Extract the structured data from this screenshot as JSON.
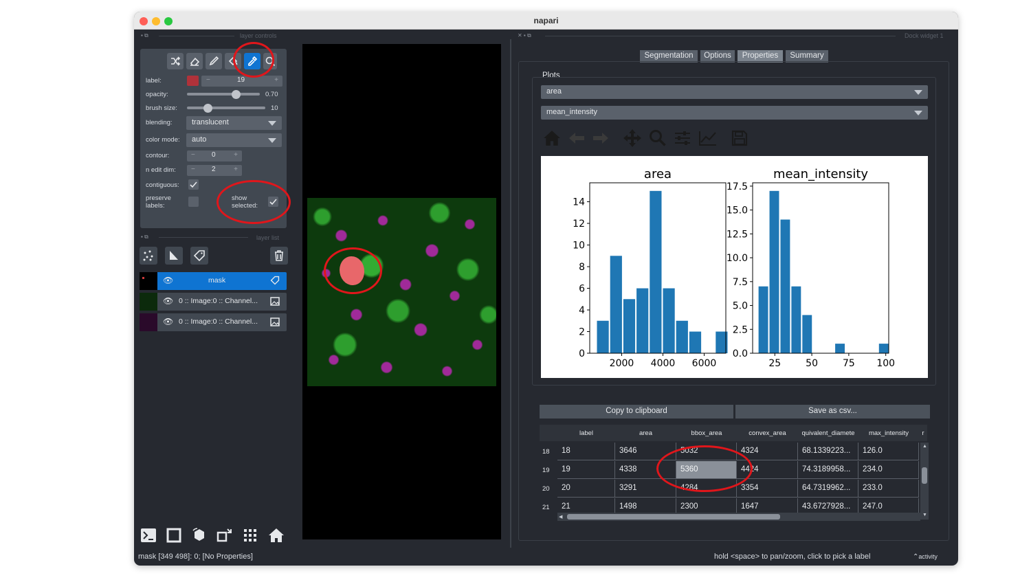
{
  "window": {
    "title": "napari"
  },
  "layer_controls": {
    "title": "layer controls",
    "label": {
      "name": "label:",
      "value": "19",
      "color": "#b0323a"
    },
    "opacity": {
      "name": "opacity:",
      "value": "0.70",
      "fraction": 0.7
    },
    "brush_size": {
      "name": "brush size:",
      "value": "10",
      "fraction": 0.2
    },
    "blending": {
      "name": "blending:",
      "value": "translucent"
    },
    "color_mode": {
      "name": "color mode:",
      "value": "auto"
    },
    "contour": {
      "name": "contour:",
      "value": "0"
    },
    "n_edit_dim": {
      "name": "n edit dim:",
      "value": "2"
    },
    "contiguous": {
      "name": "contiguous:",
      "checked": true
    },
    "preserve_labels": {
      "name": "preserve labels:",
      "checked": false
    },
    "show_selected": {
      "name": "show selected:",
      "checked": true
    },
    "tools": [
      "shuffle-icon",
      "eraser-icon",
      "paint-brush-icon",
      "fill-bucket-icon",
      "color-picker-icon",
      "zoom-icon"
    ],
    "active_tool": "color-picker-icon"
  },
  "layer_list": {
    "title": "layer list",
    "layers": [
      {
        "name": "mask",
        "selected": true
      },
      {
        "name": "0 :: Image:0 :: Channel...",
        "selected": false
      },
      {
        "name": "0 :: Image:0 :: Channel...",
        "selected": false
      }
    ]
  },
  "dock": {
    "title": "Dock widget 1",
    "tabs": [
      {
        "label": "Segmentation",
        "active": false
      },
      {
        "label": "Options",
        "active": false
      },
      {
        "label": "Properties",
        "active": true
      },
      {
        "label": "Summary",
        "active": false
      }
    ],
    "plots_label": "Plots",
    "plot_x": "area",
    "plot_y": "mean_intensity",
    "copy_button": "Copy to clipboard",
    "save_button": "Save as csv..."
  },
  "chart_data": [
    {
      "type": "bar",
      "title": "area",
      "x_tick_labels": [
        "2000",
        "4000",
        "6000"
      ],
      "x_ticks": [
        2000,
        4000,
        6000
      ],
      "y_tick_labels": [
        "0",
        "2",
        "4",
        "6",
        "8",
        "10",
        "12",
        "14"
      ],
      "ylim": [
        0,
        15.75
      ],
      "xlim": [
        450,
        7050
      ],
      "bin_starts": [
        800,
        1440,
        2080,
        2720,
        3360,
        4000,
        4640,
        5280,
        5920,
        6560
      ],
      "bin_width": 640,
      "values": [
        3,
        9,
        5,
        6,
        15,
        6,
        3,
        2,
        0,
        2
      ]
    },
    {
      "type": "bar",
      "title": "mean_intensity",
      "x_tick_labels": [
        "25",
        "50",
        "75",
        "100"
      ],
      "x_ticks": [
        25,
        50,
        75,
        100
      ],
      "y_tick_labels": [
        "0.0",
        "2.5",
        "5.0",
        "7.5",
        "10.0",
        "12.5",
        "15.0",
        "17.5"
      ],
      "ylim": [
        0,
        17.85
      ],
      "xlim": [
        10,
        102
      ],
      "bin_starts": [
        14,
        21.4,
        28.8,
        36.2,
        43.6,
        51,
        58.4,
        65.8,
        73.2,
        80.6,
        88,
        95.4
      ],
      "bin_width": 7.4,
      "values": [
        7,
        17,
        14,
        7,
        4,
        0,
        0,
        1,
        0,
        0,
        0,
        1
      ]
    }
  ],
  "table": {
    "columns": [
      "label",
      "area",
      "bbox_area",
      "convex_area",
      "quivalent_diamete",
      "max_intensity",
      "r"
    ],
    "rows": [
      {
        "index": "18",
        "cells": [
          "18",
          "3646",
          "5032",
          "4324",
          "68.1339223...",
          "126.0"
        ]
      },
      {
        "index": "19",
        "cells": [
          "19",
          "4338",
          "5360",
          "4424",
          "74.3189958...",
          "234.0"
        ]
      },
      {
        "index": "20",
        "cells": [
          "20",
          "3291",
          "4284",
          "3354",
          "64.7319962...",
          "233.0"
        ]
      },
      {
        "index": "21",
        "cells": [
          "21",
          "1498",
          "2300",
          "1647",
          "43.6727928...",
          "247.0"
        ]
      }
    ],
    "selected_cell": "5360"
  },
  "status": {
    "left": "mask [349 498]: 0; [No Properties]",
    "right": "hold <space> to pan/zoom, click to pick a label",
    "activity": "activity"
  }
}
